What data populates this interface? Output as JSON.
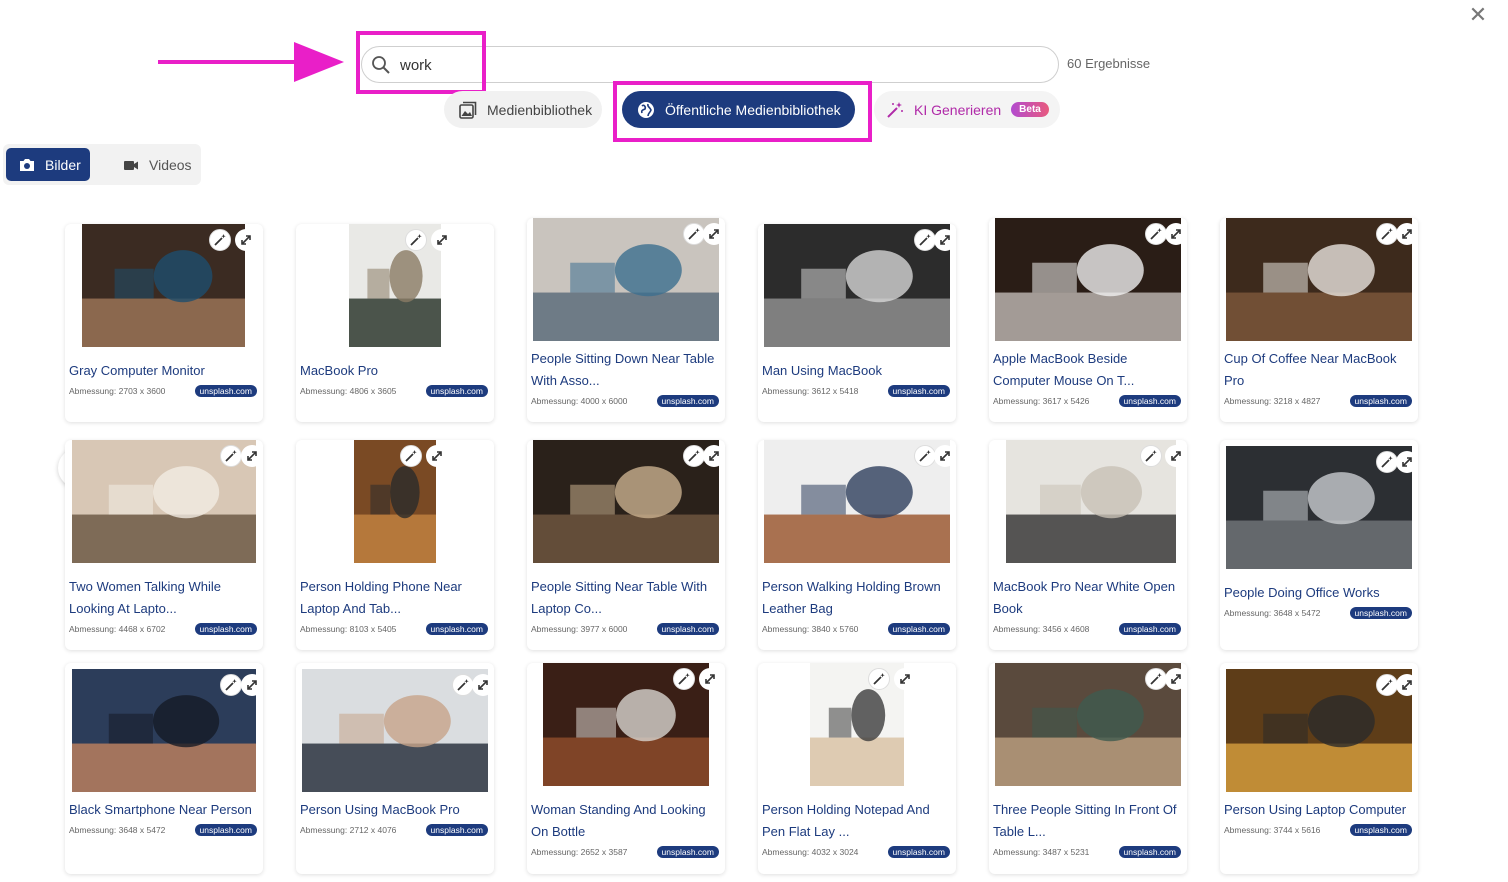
{
  "close_icon": "close-icon",
  "search": {
    "value": "work",
    "placeholder": "",
    "results_label": "60 Ergebnisse"
  },
  "source_tabs": [
    {
      "label": "Medienbibliothek",
      "icon": "image-stack-icon",
      "active": false
    },
    {
      "label": "Öffentliche Medienbibliothek",
      "icon": "globe-icon",
      "active": true
    },
    {
      "label": "KI Generieren",
      "icon": "magic-wand-icon",
      "badge": "Beta",
      "active": false
    }
  ],
  "media_types": [
    {
      "label": "Bilder",
      "icon": "camera-icon",
      "active": true
    },
    {
      "label": "Videos",
      "icon": "video-camera-icon",
      "active": false
    }
  ],
  "colors": {
    "primary": "#1d3b7e",
    "highlight": "#e91fc8",
    "ai_accent": "#b02aa8"
  },
  "cards": [
    {
      "title": "Gray Computer Monitor",
      "dimension": "Abmessung: 2703 x 3600",
      "source": "unsplash.com"
    },
    {
      "title": "MacBook Pro",
      "dimension": "Abmessung: 4806 x 3605",
      "source": "unsplash.com"
    },
    {
      "title": "People Sitting Down Near Table With Asso...",
      "dimension": "Abmessung: 4000 x 6000",
      "source": "unsplash.com"
    },
    {
      "title": "Man Using MacBook",
      "dimension": "Abmessung: 3612 x 5418",
      "source": "unsplash.com"
    },
    {
      "title": "Apple MacBook Beside Computer Mouse On T...",
      "dimension": "Abmessung: 3617 x 5426",
      "source": "unsplash.com"
    },
    {
      "title": "Cup Of Coffee Near MacBook Pro",
      "dimension": "Abmessung: 3218 x 4827",
      "source": "unsplash.com"
    },
    {
      "title": "Two Women Talking While Looking At Lapto...",
      "dimension": "Abmessung: 4468 x 6702",
      "source": "unsplash.com"
    },
    {
      "title": "Person Holding Phone Near Laptop And Tab...",
      "dimension": "Abmessung: 8103 x 5405",
      "source": "unsplash.com"
    },
    {
      "title": "People Sitting Near Table With Laptop Co...",
      "dimension": "Abmessung: 3977 x 6000",
      "source": "unsplash.com"
    },
    {
      "title": "Person Walking Holding Brown Leather Bag",
      "dimension": "Abmessung: 3840 x 5760",
      "source": "unsplash.com"
    },
    {
      "title": "MacBook Pro Near White Open Book",
      "dimension": "Abmessung: 3456 x 4608",
      "source": "unsplash.com"
    },
    {
      "title": "People Doing Office Works",
      "dimension": "Abmessung: 3648 x 5472",
      "source": "unsplash.com"
    },
    {
      "title": "Black Smartphone Near Person",
      "dimension": "Abmessung: 3648 x 5472",
      "source": "unsplash.com"
    },
    {
      "title": "Person Using MacBook Pro",
      "dimension": "Abmessung: 2712 x 4076",
      "source": "unsplash.com"
    },
    {
      "title": "Woman Standing And Looking On Bottle",
      "dimension": "Abmessung: 2652 x 3587",
      "source": "unsplash.com"
    },
    {
      "title": "Person Holding Notepad And Pen Flat Lay ...",
      "dimension": "Abmessung: 4032 x 3024",
      "source": "unsplash.com"
    },
    {
      "title": "Three People Sitting In Front Of Table L...",
      "dimension": "Abmessung: 3487 x 5231",
      "source": "unsplash.com"
    },
    {
      "title": "Person Using Laptop Computer",
      "dimension": "Abmessung: 3744 x 5616",
      "source": "unsplash.com"
    }
  ]
}
